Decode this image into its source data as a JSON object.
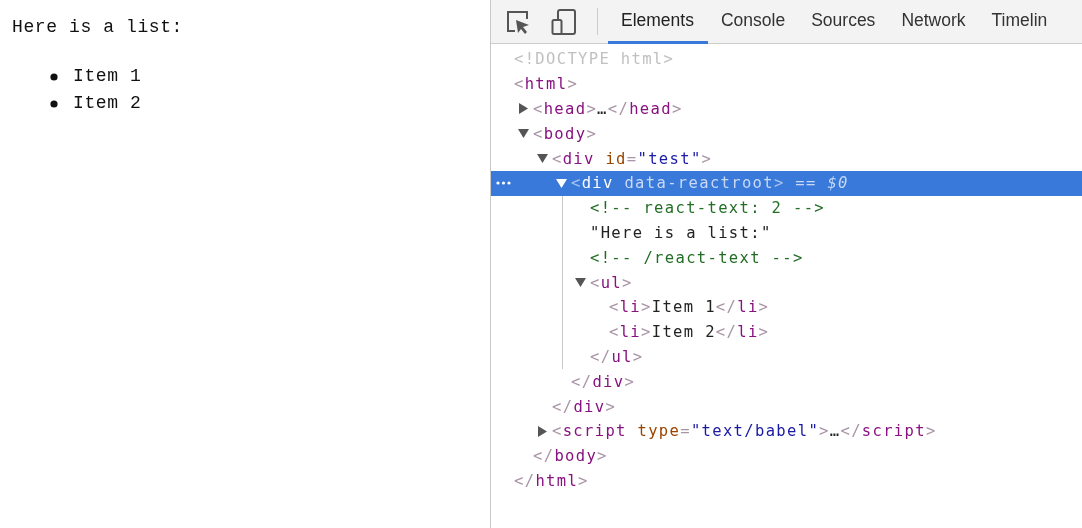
{
  "page": {
    "text": "Here is a list:",
    "list_items": [
      "Item 1",
      "Item 2"
    ]
  },
  "devtools": {
    "tabs": [
      {
        "label": "Elements",
        "selected": true
      },
      {
        "label": "Console",
        "selected": false
      },
      {
        "label": "Sources",
        "selected": false
      },
      {
        "label": "Network",
        "selected": false
      },
      {
        "label": "Timelin",
        "selected": false
      }
    ],
    "dom_tree": [
      {
        "selected": false,
        "open": [
          {
            "kind": "doctype",
            "text": "<!DOCTYPE html>"
          }
        ]
      },
      {
        "selected": false,
        "open": [
          {
            "kind": "punct",
            "text": "<"
          },
          {
            "kind": "tag",
            "text": "html"
          },
          {
            "kind": "punct",
            "text": ">"
          }
        ],
        "children": [
          {
            "selected": false,
            "expanded": false,
            "open": [
              {
                "kind": "punct",
                "text": "<"
              },
              {
                "kind": "tag",
                "text": "head"
              },
              {
                "kind": "punct",
                "text": ">"
              },
              {
                "kind": "text",
                "text": "…"
              },
              {
                "kind": "punct",
                "text": "</"
              },
              {
                "kind": "tag",
                "text": "head"
              },
              {
                "kind": "punct",
                "text": ">"
              }
            ]
          },
          {
            "selected": false,
            "expanded": true,
            "open": [
              {
                "kind": "punct",
                "text": "<"
              },
              {
                "kind": "tag",
                "text": "body"
              },
              {
                "kind": "punct",
                "text": ">"
              }
            ],
            "children": [
              {
                "selected": false,
                "expanded": true,
                "open": [
                  {
                    "kind": "punct",
                    "text": "<"
                  },
                  {
                    "kind": "tag",
                    "text": "div"
                  },
                  {
                    "kind": "attr",
                    "text": "id"
                  },
                  {
                    "kind": "punct",
                    "text": "="
                  },
                  {
                    "kind": "value",
                    "text": "\"test\""
                  },
                  {
                    "kind": "punct",
                    "text": ">"
                  }
                ],
                "children": [
                  {
                    "selected": true,
                    "expanded": true,
                    "open": [
                      {
                        "kind": "punct",
                        "text": "<"
                      },
                      {
                        "kind": "tag",
                        "text": "div"
                      },
                      {
                        "kind": "attr",
                        "text": "data-reactroot"
                      },
                      {
                        "kind": "punct",
                        "text": ">"
                      },
                      {
                        "kind": "hint",
                        "text": " == *$0*"
                      }
                    ],
                    "children": [
                      {
                        "selected": false,
                        "open": [
                          {
                            "kind": "comment",
                            "text": "<!-- react-text: 2 -->"
                          }
                        ]
                      },
                      {
                        "selected": false,
                        "open": [
                          {
                            "kind": "text",
                            "text": "\"Here is a list:\""
                          }
                        ]
                      },
                      {
                        "selected": false,
                        "open": [
                          {
                            "kind": "comment",
                            "text": "<!-- /react-text -->"
                          }
                        ]
                      },
                      {
                        "selected": false,
                        "expanded": true,
                        "open": [
                          {
                            "kind": "punct",
                            "text": "<"
                          },
                          {
                            "kind": "tag",
                            "text": "ul"
                          },
                          {
                            "kind": "punct",
                            "text": ">"
                          }
                        ],
                        "children": [
                          {
                            "selected": false,
                            "open": [
                              {
                                "kind": "punct",
                                "text": "<"
                              },
                              {
                                "kind": "tag",
                                "text": "li"
                              },
                              {
                                "kind": "punct",
                                "text": ">"
                              },
                              {
                                "kind": "text",
                                "text": "Item 1"
                              },
                              {
                                "kind": "punct",
                                "text": "</"
                              },
                              {
                                "kind": "tag",
                                "text": "li"
                              },
                              {
                                "kind": "punct",
                                "text": ">"
                              }
                            ]
                          },
                          {
                            "selected": false,
                            "open": [
                              {
                                "kind": "punct",
                                "text": "<"
                              },
                              {
                                "kind": "tag",
                                "text": "li"
                              },
                              {
                                "kind": "punct",
                                "text": ">"
                              },
                              {
                                "kind": "text",
                                "text": "Item 2"
                              },
                              {
                                "kind": "punct",
                                "text": "</"
                              },
                              {
                                "kind": "tag",
                                "text": "li"
                              },
                              {
                                "kind": "punct",
                                "text": ">"
                              }
                            ]
                          }
                        ],
                        "close": [
                          {
                            "kind": "punct",
                            "text": "</"
                          },
                          {
                            "kind": "tag",
                            "text": "ul"
                          },
                          {
                            "kind": "punct",
                            "text": ">"
                          }
                        ]
                      }
                    ],
                    "close": [
                      {
                        "kind": "punct",
                        "text": "</"
                      },
                      {
                        "kind": "tag",
                        "text": "div"
                      },
                      {
                        "kind": "punct",
                        "text": ">"
                      }
                    ]
                  }
                ],
                "close": [
                  {
                    "kind": "punct",
                    "text": "</"
                  },
                  {
                    "kind": "tag",
                    "text": "div"
                  },
                  {
                    "kind": "punct",
                    "text": ">"
                  }
                ]
              },
              {
                "selected": false,
                "expanded": false,
                "open": [
                  {
                    "kind": "punct",
                    "text": "<"
                  },
                  {
                    "kind": "tag",
                    "text": "script"
                  },
                  {
                    "kind": "attr",
                    "text": "type"
                  },
                  {
                    "kind": "punct",
                    "text": "="
                  },
                  {
                    "kind": "value",
                    "text": "\"text/babel\""
                  },
                  {
                    "kind": "punct",
                    "text": ">"
                  },
                  {
                    "kind": "text",
                    "text": "…"
                  },
                  {
                    "kind": "punct",
                    "text": "</"
                  },
                  {
                    "kind": "tag",
                    "text": "script"
                  },
                  {
                    "kind": "punct",
                    "text": ">"
                  }
                ]
              }
            ],
            "close": [
              {
                "kind": "punct",
                "text": "</"
              },
              {
                "kind": "tag",
                "text": "body"
              },
              {
                "kind": "punct",
                "text": ">"
              }
            ]
          }
        ],
        "close": [
          {
            "kind": "punct",
            "text": "</"
          },
          {
            "kind": "tag",
            "text": "html"
          },
          {
            "kind": "punct",
            "text": ">"
          }
        ]
      }
    ]
  }
}
